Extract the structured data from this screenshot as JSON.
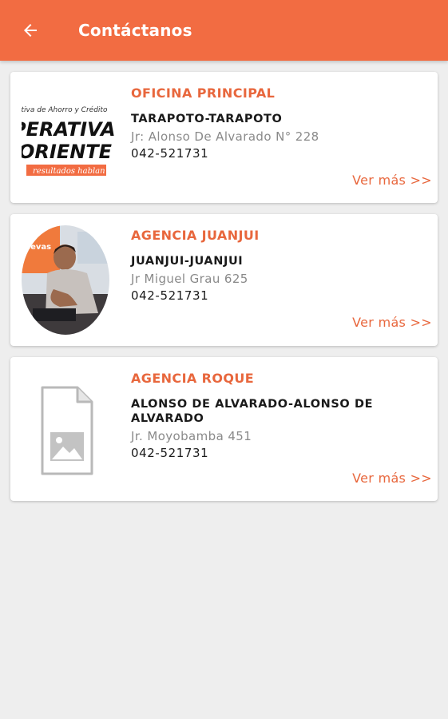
{
  "header": {
    "title": "Contáctanos",
    "back_icon": "arrow-back-icon",
    "bg_color": "#f26c42"
  },
  "cards": [
    {
      "name": "OFICINA PRINCIPAL",
      "city": "TARAPOTO-TARAPOTO",
      "address": "Jr: Alonso De Alvarado N° 228",
      "phone": "042-521731",
      "more": "Ver más >>",
      "image": {
        "line1": "ativa de Ahorro y Crédito",
        "line2": "PERATIVA",
        "line3": "ORIENTE",
        "line4": "resultados hablan"
      }
    },
    {
      "name": "AGENCIA JUANJUI",
      "city": "JUANJUI-JUANJUI",
      "address": "Jr Miguel Grau 625",
      "phone": "042-521731",
      "more": "Ver más >>",
      "image": {
        "label": "uevas"
      }
    },
    {
      "name": "AGENCIA ROQUE",
      "city": "ALONSO DE ALVARADO-ALONSO DE ALVARADO",
      "address": "Jr. Moyobamba 451",
      "phone": "042-521731",
      "more": "Ver más >>",
      "image": {
        "icon": "image-placeholder-icon"
      }
    }
  ],
  "colors": {
    "accent": "#e8673d",
    "text": "#1a1a1a",
    "secondary_text": "#8a8a8a",
    "background": "#eeeeee"
  }
}
